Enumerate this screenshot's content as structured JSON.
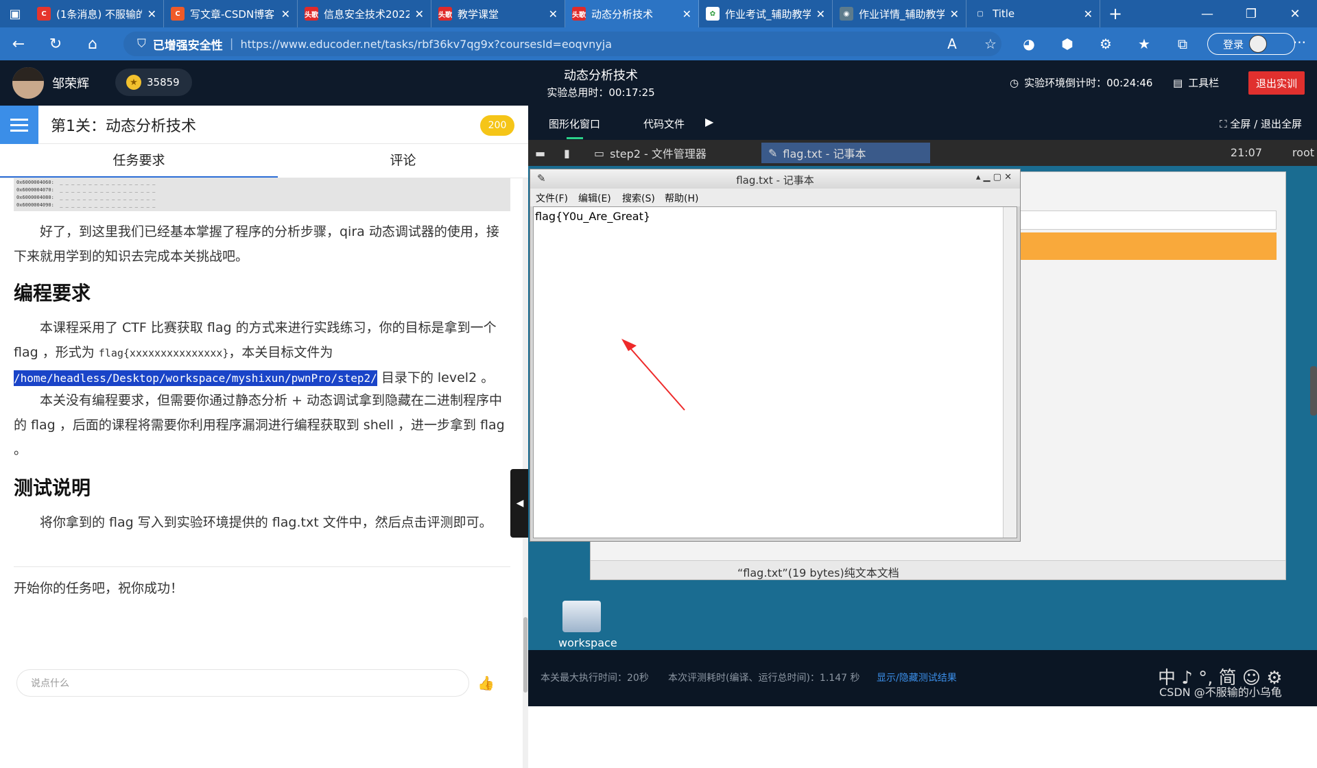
{
  "browser": {
    "tabs": [
      {
        "title": "(1条消息) 不服输的",
        "favicon": "C",
        "color": "#e5352d"
      },
      {
        "title": "写文章-CSDN博客",
        "favicon": "C",
        "color": "#f05a28"
      },
      {
        "title": "信息安全技术2022",
        "favicon": "头歌",
        "color": "#e02a2a"
      },
      {
        "title": "教学课堂",
        "favicon": "头歌",
        "color": "#e02a2a"
      },
      {
        "title": "动态分析技术",
        "favicon": "头歌",
        "color": "#e02a2a"
      },
      {
        "title": "作业考试_辅助教学",
        "favicon": "✿",
        "color": "#ffffff"
      },
      {
        "title": "作业详情_辅助教学",
        "favicon": "◉",
        "color": "#5d7b8c"
      },
      {
        "title": "Title",
        "favicon": "▢",
        "color": "#1f5ea5"
      }
    ],
    "security_label": "已增强安全性",
    "url": "https://www.educoder.net/tasks/rbf36kv7qg9x?coursesId=eoqvnyja",
    "login_label": "登录"
  },
  "header": {
    "username": "邹荣辉",
    "coins": "35859",
    "course_title": "动态分析技术",
    "time_used": "实验总用时：00:17:25",
    "countdown": "实验环境倒计时：00:24:46",
    "toolbox": "工具栏",
    "exit": "退出实训"
  },
  "left": {
    "level_title": "第1关：动态分析技术",
    "score": "200",
    "tabs": [
      "任务要求",
      "评论"
    ],
    "mem_lines": [
      "0x6000004060:  _ _ _ _ _ _ _ _ _ _ _ _ _ _ _ _ _",
      "0x6000004070:  _ _ _ _ _ _ _ _ _ _ _ _ _ _ _ _ _",
      "0x6000004080:  _ _ _ _ _ _ _ _ _ _ _ _ _ _ _ _ _",
      "0x6000004090:  _ _ _ _ _ _ _ _ _ _ _ _ _ _ _ _ _"
    ],
    "p1": "好了，到这里我们已经基本掌握了程序的分析步骤，qira 动态调试器的使用，接下来就用学到的知识去完成本关挑战吧。",
    "h_prog": "编程要求",
    "p2a": "本课程采用了 CTF 比赛获取 flag 的方式来进行实践练习，你的目标是拿到一个 flag ，形式为",
    "p2code": "flag{xxxxxxxxxxxxxxx}",
    "p2b": "，本关目标文件为",
    "p2path": "/home/headless/Desktop/workspace/myshixun/pwnPro/step2/",
    "p2c": "目录下的 level2 。",
    "p3": "本关没有编程要求，但需要你通过静态分析 + 动态调试拿到隐藏在二进制程序中的 flag ，后面的课程将需要你利用程序漏洞进行编程获取到 shell ，进一步拿到 flag 。",
    "h_test": "测试说明",
    "p4": "将你拿到的 flag 写入到实验环境提供的 flag.txt 文件中，然后点击评测即可。",
    "p5": "开始你的任务吧，祝你成功！",
    "comment_placeholder": "说点什么"
  },
  "right": {
    "tabs": [
      "图形化窗口",
      "代码文件"
    ],
    "fullscreen": "全屏 / 退出全屏",
    "taskbar": {
      "fm": "step2 - 文件管理器",
      "np": "flag.txt - 记事本",
      "clock": "21:07",
      "user": "root"
    },
    "notepad": {
      "title": "flag.txt - 记事本",
      "menus": [
        "文件(F)",
        "编辑(E)",
        "搜索(S)",
        "帮助(H)"
      ],
      "content": "flag{Y0u_Are_Great}"
    },
    "fm_status": "“flag.txt”(19 bytes)纯文本文档",
    "desktop_icon": "workspace",
    "status": {
      "max_time": "本关最大执行时间：20秒",
      "eval_time": "本次评测耗时(编译、运行总时间)：1.147 秒",
      "toggle": "显示/隐藏测试结果"
    },
    "ime": "中 ♪ °, 简 ☺ ⚙",
    "watermark": "CSDN @不服输的小乌龟"
  }
}
